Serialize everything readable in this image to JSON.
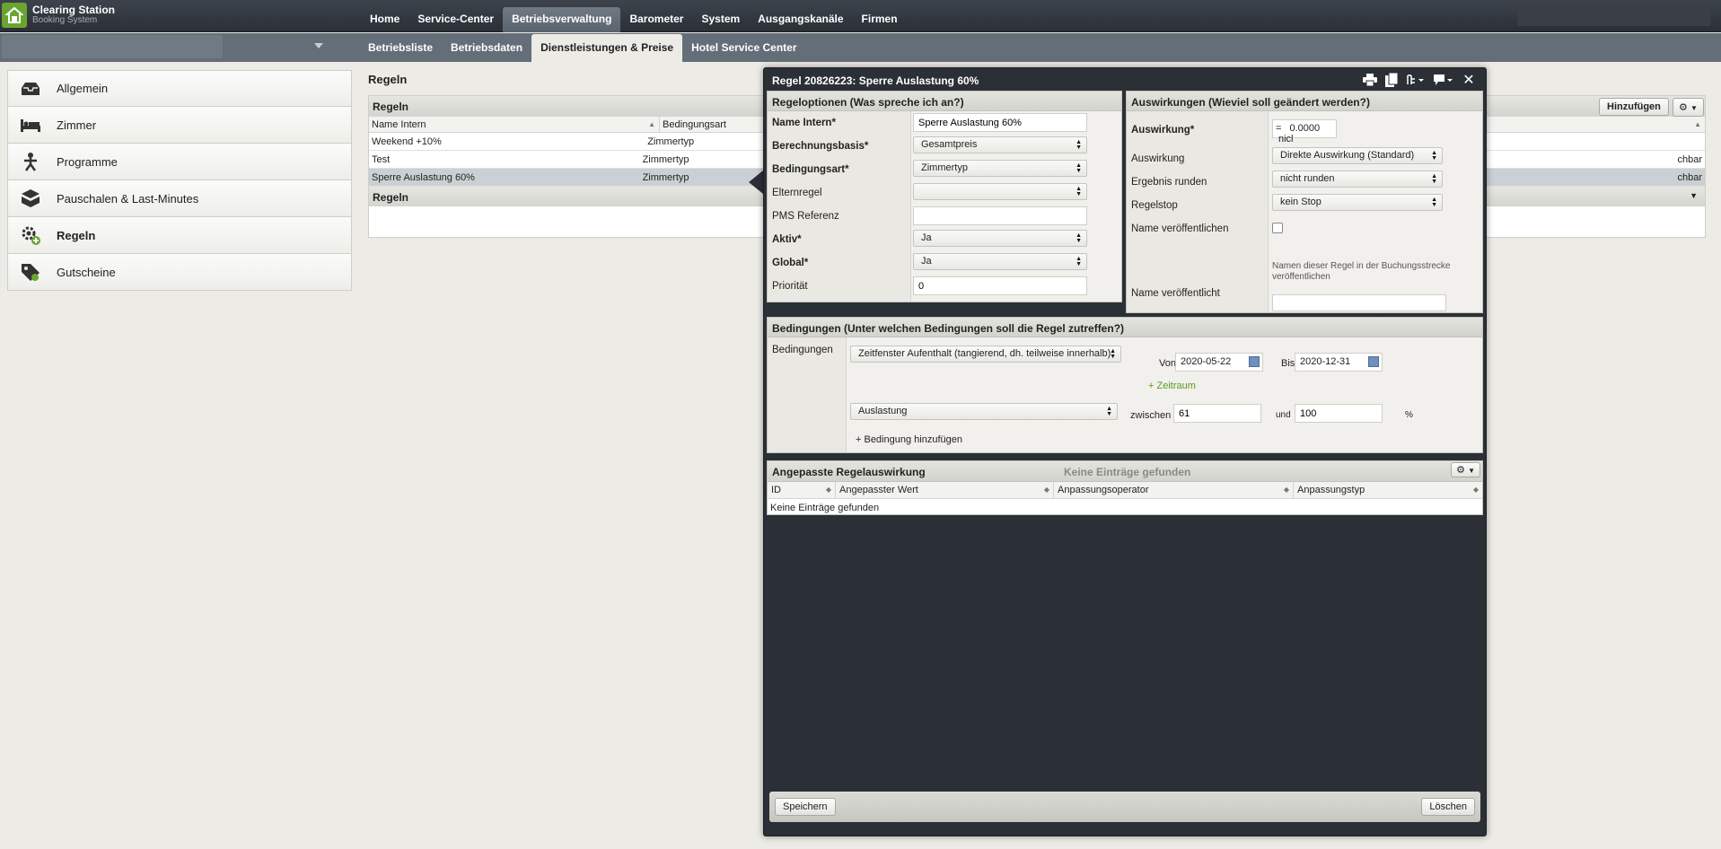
{
  "app": {
    "title": "Clearing Station",
    "subtitle": "Booking System"
  },
  "mainnav": [
    "Home",
    "Service-Center",
    "Betriebsverwaltung",
    "Barometer",
    "System",
    "Ausgangskanäle",
    "Firmen"
  ],
  "subnav": [
    "Betriebsliste",
    "Betriebsdaten",
    "Dienstleistungen & Preise",
    "Hotel Service Center"
  ],
  "sidebar": {
    "items": [
      {
        "label": "Allgemein"
      },
      {
        "label": "Zimmer"
      },
      {
        "label": "Programme"
      },
      {
        "label": "Pauschalen & Last-Minutes"
      },
      {
        "label": "Regeln"
      },
      {
        "label": "Gutscheine"
      }
    ]
  },
  "content": {
    "title": "Regeln",
    "table_title": "Regeln",
    "add_button": "Hinzufügen",
    "columns": [
      "Name Intern",
      "Bedingungsart"
    ],
    "rows": [
      {
        "name": "Weekend +10%",
        "type": "Zimmertyp",
        "extra": ""
      },
      {
        "name": "Test",
        "type": "Zimmertyp",
        "extra": "chbar"
      },
      {
        "name": "Sperre Auslastung 60%",
        "type": "Zimmertyp",
        "extra": "chbar"
      }
    ],
    "sub_title": "Regeln"
  },
  "dialog": {
    "title": "Regel 20826223: Sperre Auslastung 60%",
    "options": {
      "header": "Regeloptionen (Was spreche ich an?)",
      "name_label": "Name Intern*",
      "name_value": "Sperre Auslastung 60%",
      "basis_label": "Berechnungsbasis*",
      "basis_value": "Gesamtpreis",
      "condtype_label": "Bedingungsart*",
      "condtype_value": "Zimmertyp",
      "parent_label": "Elternregel",
      "parent_value": "",
      "pms_label": "PMS Referenz",
      "pms_value": "",
      "active_label": "Aktiv*",
      "active_value": "Ja",
      "global_label": "Global*",
      "global_value": "Ja",
      "priority_label": "Priorität",
      "priority_value": "0"
    },
    "effects": {
      "header": "Auswirkungen (Wieviel soll geändert werden?)",
      "effect_req_label": "Auswirkung*",
      "effect_operator": "=",
      "effect_value": "0.0000",
      "effect_unit": "nicl",
      "effect_label": "Auswirkung",
      "effect_select": "Direkte Auswirkung (Standard)",
      "round_label": "Ergebnis runden",
      "round_select": "nicht runden",
      "stop_label": "Regelstop",
      "stop_select": "kein Stop",
      "publish_label": "Name veröffentlichen",
      "publish_hint": "Namen dieser Regel in der Buchungsstrecke veröffentlichen",
      "published_label": "Name veröffentlicht",
      "published_value": ""
    },
    "conditions": {
      "header": "Bedingungen (Unter welchen Bedingungen soll die Regel zutreffen?)",
      "label": "Bedingungen",
      "cond1_select": "Zeitfenster Aufenthalt (tangierend, dh. teilweise innerhalb)",
      "from_label": "Von",
      "from_value": "2020-05-22",
      "to_label": "Bis",
      "to_value": "2020-12-31",
      "add_period": "+ Zeitraum",
      "cond2_select": "Auslastung",
      "between_label": "zwischen",
      "between_from": "61",
      "and_label": "und",
      "between_to": "100",
      "percent": "%",
      "add_condition": "+ Bedingung hinzufügen"
    },
    "adjusted": {
      "header": "Angepasste Regelauswirkung",
      "empty_header": "Keine Einträge gefunden",
      "columns": [
        "ID",
        "Angepasster Wert",
        "Anpassungsoperator",
        "Anpassungstyp"
      ],
      "empty": "Keine Einträge gefunden"
    },
    "footer": {
      "save": "Speichern",
      "delete": "Löschen"
    }
  },
  "colors": {
    "topbar": "#2b3037",
    "accent": "#6aa531",
    "selected_row": "#cbd0d5"
  }
}
